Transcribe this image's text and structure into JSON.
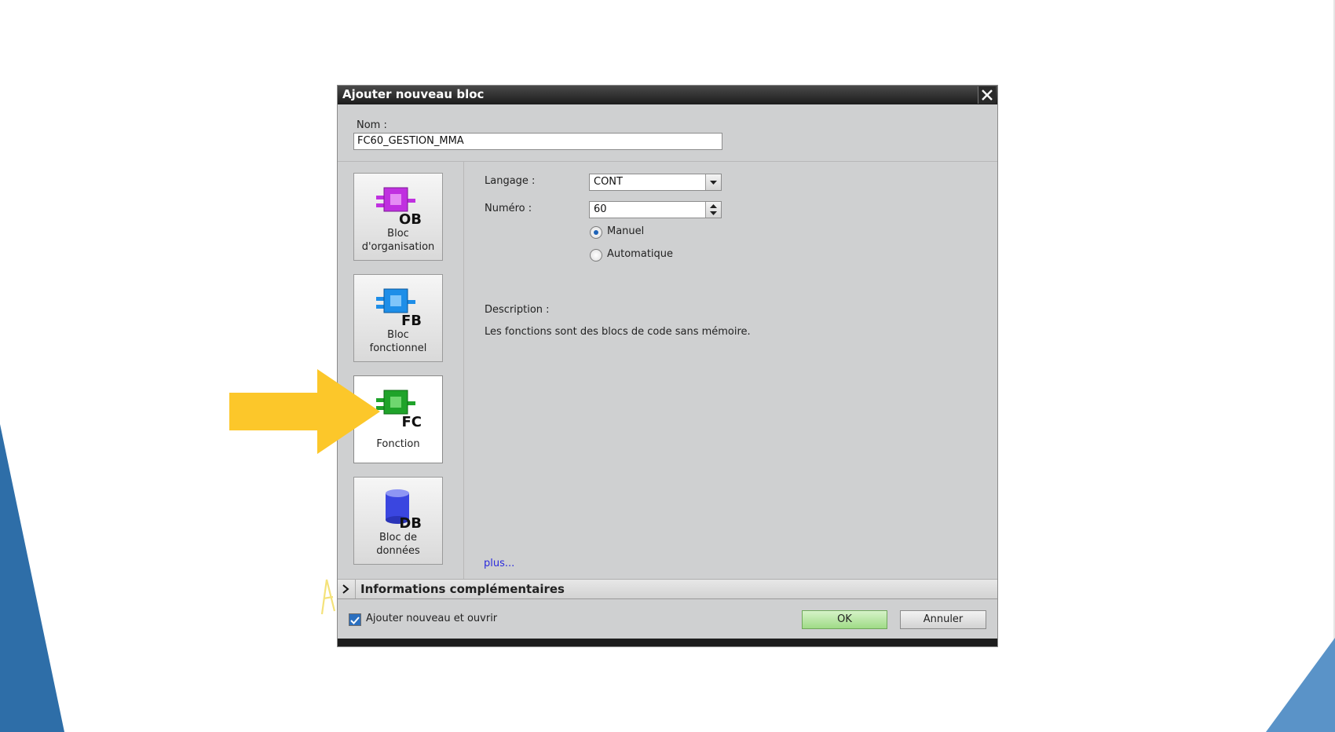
{
  "dialog": {
    "title": "Ajouter nouveau bloc",
    "name_label": "Nom :",
    "name_value": "FC60_GESTION_MMA"
  },
  "blocks": [
    {
      "badge": "OB",
      "label_line1": "Bloc",
      "label_line2": "d'organisation",
      "color": "#c030e0",
      "selected": false
    },
    {
      "badge": "FB",
      "label_line1": "Bloc",
      "label_line2": "fonctionnel",
      "color": "#1e8ee8",
      "selected": false
    },
    {
      "badge": "FC",
      "label_line1": "Fonction",
      "label_line2": "",
      "color": "#1fa32a",
      "selected": true
    },
    {
      "badge": "DB",
      "label_line1": "Bloc de",
      "label_line2": "données",
      "color": "#3a46e0",
      "selected": false
    }
  ],
  "settings": {
    "language_label": "Langage :",
    "language_value": "CONT",
    "number_label": "Numéro :",
    "number_value": "60",
    "radio_manual": "Manuel",
    "radio_auto": "Automatique",
    "numbering_mode": "Manuel",
    "description_label": "Description :",
    "description_text": "Les fonctions sont des blocs de code sans mémoire.",
    "more_link": "plus..."
  },
  "info_bar": {
    "label": "Informations complémentaires"
  },
  "footer": {
    "add_open_label": "Ajouter nouveau et ouvrir",
    "add_open_checked": true,
    "ok_label": "OK",
    "cancel_label": "Annuler"
  },
  "colors": {
    "arrow": "#fcc72a",
    "slide_accent": "#2e6ea8",
    "ok_green": "#9fdb86"
  },
  "icons": {
    "close": "close-icon",
    "expand": "chevron-right-icon",
    "dropdown": "chevron-down-icon",
    "spinner": "spinner-arrows-icon",
    "annotation_arrow": "pointer-arrow-icon"
  }
}
